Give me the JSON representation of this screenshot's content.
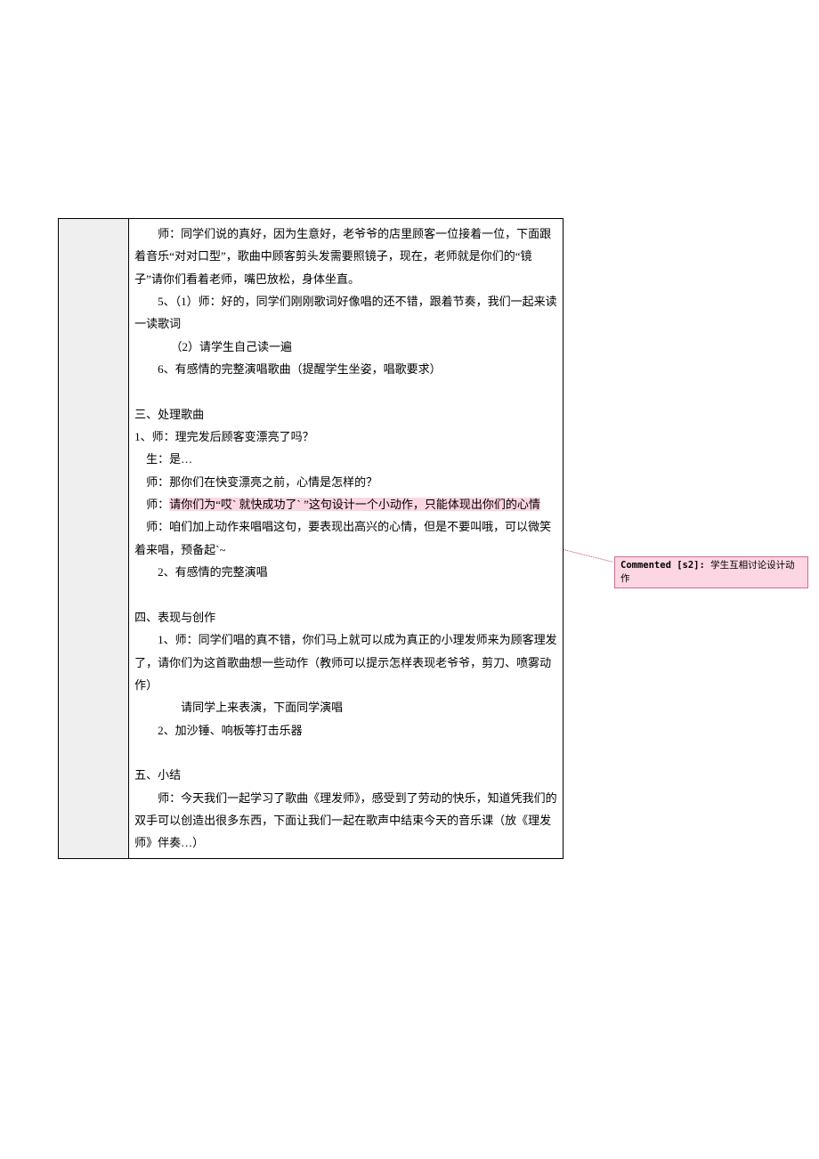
{
  "content": {
    "p1": "师：同学们说的真好，因为生意好，老爷爷的店里顾客一位接着一位，下面跟着音乐“对对口型”，歌曲中顾客剪头发需要照镜子，现在，老师就是你们的“镜子”请你们看着老师，嘴巴放松，身体坐直。",
    "p2": "5、（1）师：好的，同学们刚刚歌词好像唱的还不错，跟着节奏，我们一起来读一读歌词",
    "p3": "（2）请学生自己读一遍",
    "p4": "6、有感情的完整演唱歌曲（提醒学生坐姿，唱歌要求）",
    "h3": "三、处理歌曲",
    "p5": "1、师：理完发后顾客变漂亮了吗？",
    "p6": "生：是…",
    "p7": "师：那你们在快变漂亮之前，心情是怎样的？",
    "p8a": "师：",
    "p8h": "请你们为“哎` 就快成功了` ”这句设计一个小动作，只能体现出你们的心情",
    "p9": "师：咱们加上动作来唱唱这句，要表现出高兴的心情，但是不要叫哦，可以微笑着来唱，预备起`~",
    "p10": "2、有感情的完整演唱",
    "h4": "四、表现与创作",
    "p11": "1、师：同学们唱的真不错，你们马上就可以成为真正的小理发师来为顾客理发了，请你们为这首歌曲想一些动作（教师可以提示怎样表现老爷爷，剪刀、喷雾动作）",
    "p12": "请同学上来表演，下面同学演唱",
    "p13": "2、加沙锤、响板等打击乐器",
    "h5": "五、小结",
    "p14": "师：今天我们一起学习了歌曲《理发师》，感受到了劳动的快乐，知道凭我们的双手可以创造出很多东西，下面让我们一起在歌声中结束今天的音乐课（放《理发师》伴奏…）"
  },
  "comment": {
    "label": "Commented [s2]: ",
    "text": "学生互相讨论设计动作"
  }
}
